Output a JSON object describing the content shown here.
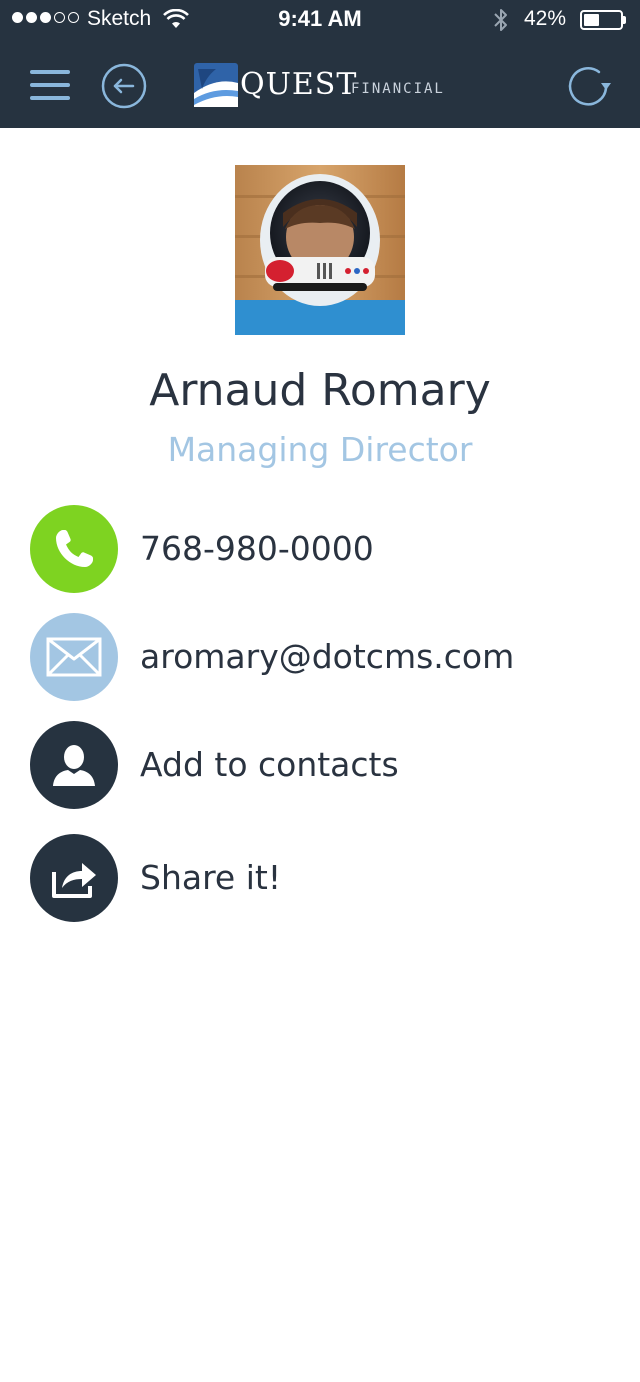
{
  "status_bar": {
    "carrier": "Sketch",
    "time": "9:41 AM",
    "battery_percent": "42%",
    "battery_level": 0.42,
    "signal_bars_filled": 3,
    "signal_bars_total": 5
  },
  "header": {
    "menu_icon": "hamburger-menu-icon",
    "back_icon": "back-arrow-icon",
    "refresh_icon": "refresh-icon",
    "logo": {
      "brand": "QUEST",
      "brand_sub": "FINANCIAL"
    }
  },
  "colors": {
    "header_bg": "#263340",
    "accent_blue": "#8ab7dc",
    "phone_green": "#7ed321",
    "mail_blue": "#a3c6e3",
    "dark_circle": "#263340"
  },
  "profile": {
    "name": "Arnaud Romary",
    "title": "Managing Director"
  },
  "actions": [
    {
      "label": "768-980-0000",
      "icon": "phone-icon"
    },
    {
      "label": "aromary@dotcms.com",
      "icon": "mail-icon"
    },
    {
      "label": "Add to contacts",
      "icon": "person-icon"
    },
    {
      "label": "Share it!",
      "icon": "share-icon"
    }
  ]
}
